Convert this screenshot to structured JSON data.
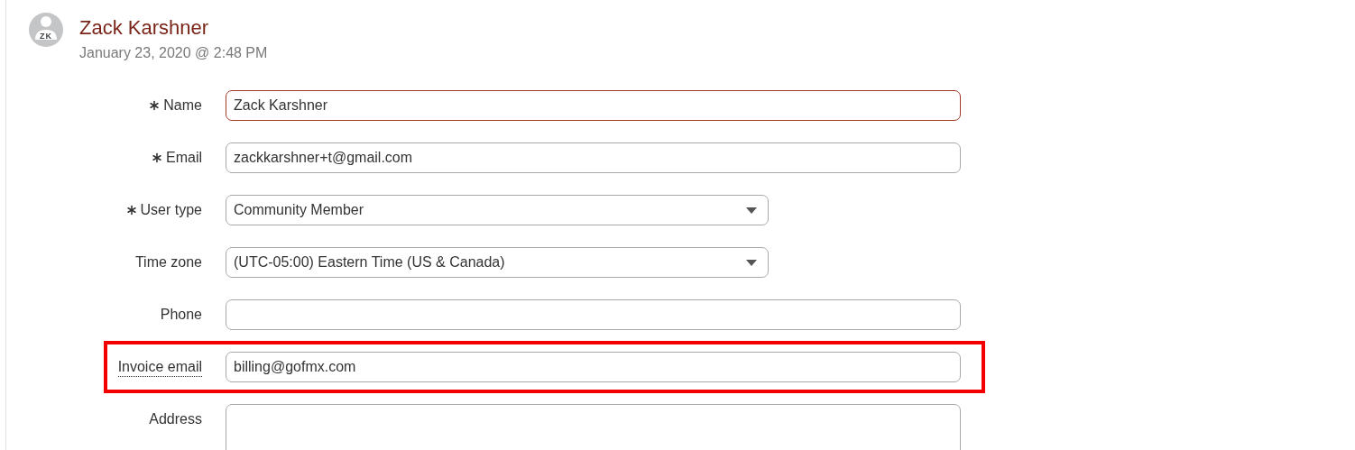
{
  "header": {
    "avatar": {
      "initials": "ZK"
    },
    "name": "Zack Karshner",
    "timestamp": "January 23, 2020 @ 2:48 PM"
  },
  "fields": [
    {
      "kind": "text",
      "label": "Name",
      "required": true,
      "value": "Zack Karshner",
      "focused": true,
      "highlighted": false,
      "hint": false
    },
    {
      "kind": "text",
      "label": "Email",
      "required": true,
      "value": "zackkarshner+t@gmail.com",
      "focused": false,
      "highlighted": false,
      "hint": false
    },
    {
      "kind": "select",
      "label": "User type",
      "required": true,
      "value": "Community Member",
      "focused": false,
      "highlighted": false,
      "hint": false
    },
    {
      "kind": "select",
      "label": "Time zone",
      "required": false,
      "value": "(UTC-05:00) Eastern Time (US & Canada)",
      "focused": false,
      "highlighted": false,
      "hint": false
    },
    {
      "kind": "text",
      "label": "Phone",
      "required": false,
      "focused": false,
      "highlighted": false,
      "hint": false
    },
    {
      "kind": "text",
      "label": "Invoice email",
      "required": false,
      "value": "billing@gofmx.com",
      "focused": false,
      "highlighted": true,
      "hint": true
    },
    {
      "kind": "textarea",
      "label": "Address",
      "required": false,
      "focused": false,
      "highlighted": false,
      "hint": false
    }
  ]
}
